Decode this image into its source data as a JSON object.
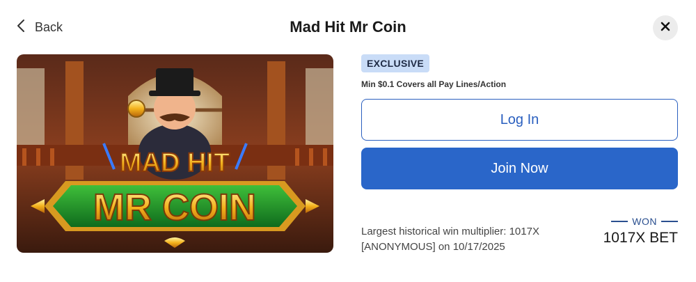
{
  "header": {
    "back_label": "Back",
    "title": "Mad Hit Mr Coin"
  },
  "icons": {
    "back": "chevron-left-icon",
    "close": "close-icon"
  },
  "game": {
    "image_text_top": "MAD HIT",
    "image_text_bottom": "MR COIN",
    "badge": "EXCLUSIVE",
    "min_bet_text": "Min $0.1 Covers all Pay Lines/Action"
  },
  "actions": {
    "login_label": "Log In",
    "join_label": "Join Now"
  },
  "stats": {
    "multiplier_text": "Largest historical win multiplier: 1017X",
    "winner_text": "[ANONYMOUS] on 10/17/2025",
    "won_label": "WON",
    "won_value": "1017X BET"
  },
  "colors": {
    "primary": "#2a66c9",
    "badge_bg": "#c9dcf7",
    "close_bg": "#ececec"
  }
}
